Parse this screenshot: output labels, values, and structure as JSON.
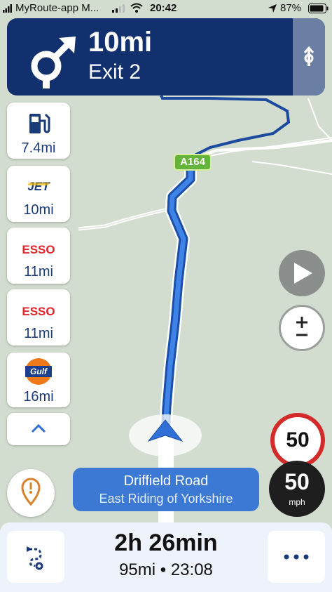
{
  "status_bar": {
    "carrier": "MyRoute-app M...",
    "time": "20:42",
    "battery": "87%"
  },
  "maneuver": {
    "distance": "10mi",
    "instruction": "Exit 2",
    "icon": "roundabout-exit-icon",
    "toggle_icon": "lane-toggle-icon"
  },
  "road_badge": "A164",
  "pois": [
    {
      "type": "fuel",
      "icon": "fuel-pump-icon",
      "distance": "7.4mi"
    },
    {
      "type": "fuel",
      "brand": "JET",
      "distance": "10mi"
    },
    {
      "type": "fuel",
      "brand": "ESSO",
      "distance": "11mi"
    },
    {
      "type": "fuel",
      "brand": "ESSO",
      "distance": "11mi"
    },
    {
      "type": "fuel",
      "brand": "Gulf",
      "distance": "16mi"
    }
  ],
  "speed_limit": "50",
  "current_speed": {
    "value": "50",
    "unit": "mph"
  },
  "current_street": {
    "name": "Driffield Road",
    "region": "East Riding of Yorkshire"
  },
  "trip": {
    "duration": "2h 26min",
    "summary": "95mi • 23:08"
  },
  "colors": {
    "nav_banner": "#13306e",
    "route": "#2f6fd6",
    "street_banner": "#3b79d5",
    "speed_limit_ring": "#d32a2a",
    "report_icon": "#d9822b",
    "map_land": "#d2dccf"
  }
}
